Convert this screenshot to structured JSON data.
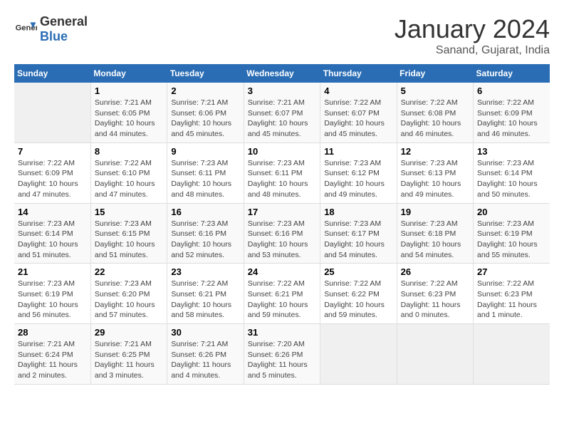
{
  "header": {
    "logo_general": "General",
    "logo_blue": "Blue",
    "month_title": "January 2024",
    "subtitle": "Sanand, Gujarat, India"
  },
  "weekdays": [
    "Sunday",
    "Monday",
    "Tuesday",
    "Wednesday",
    "Thursday",
    "Friday",
    "Saturday"
  ],
  "weeks": [
    [
      {
        "day": "",
        "info": ""
      },
      {
        "day": "1",
        "info": "Sunrise: 7:21 AM\nSunset: 6:05 PM\nDaylight: 10 hours\nand 44 minutes."
      },
      {
        "day": "2",
        "info": "Sunrise: 7:21 AM\nSunset: 6:06 PM\nDaylight: 10 hours\nand 45 minutes."
      },
      {
        "day": "3",
        "info": "Sunrise: 7:21 AM\nSunset: 6:07 PM\nDaylight: 10 hours\nand 45 minutes."
      },
      {
        "day": "4",
        "info": "Sunrise: 7:22 AM\nSunset: 6:07 PM\nDaylight: 10 hours\nand 45 minutes."
      },
      {
        "day": "5",
        "info": "Sunrise: 7:22 AM\nSunset: 6:08 PM\nDaylight: 10 hours\nand 46 minutes."
      },
      {
        "day": "6",
        "info": "Sunrise: 7:22 AM\nSunset: 6:09 PM\nDaylight: 10 hours\nand 46 minutes."
      }
    ],
    [
      {
        "day": "7",
        "info": "Sunrise: 7:22 AM\nSunset: 6:09 PM\nDaylight: 10 hours\nand 47 minutes."
      },
      {
        "day": "8",
        "info": "Sunrise: 7:22 AM\nSunset: 6:10 PM\nDaylight: 10 hours\nand 47 minutes."
      },
      {
        "day": "9",
        "info": "Sunrise: 7:23 AM\nSunset: 6:11 PM\nDaylight: 10 hours\nand 48 minutes."
      },
      {
        "day": "10",
        "info": "Sunrise: 7:23 AM\nSunset: 6:11 PM\nDaylight: 10 hours\nand 48 minutes."
      },
      {
        "day": "11",
        "info": "Sunrise: 7:23 AM\nSunset: 6:12 PM\nDaylight: 10 hours\nand 49 minutes."
      },
      {
        "day": "12",
        "info": "Sunrise: 7:23 AM\nSunset: 6:13 PM\nDaylight: 10 hours\nand 49 minutes."
      },
      {
        "day": "13",
        "info": "Sunrise: 7:23 AM\nSunset: 6:14 PM\nDaylight: 10 hours\nand 50 minutes."
      }
    ],
    [
      {
        "day": "14",
        "info": "Sunrise: 7:23 AM\nSunset: 6:14 PM\nDaylight: 10 hours\nand 51 minutes."
      },
      {
        "day": "15",
        "info": "Sunrise: 7:23 AM\nSunset: 6:15 PM\nDaylight: 10 hours\nand 51 minutes."
      },
      {
        "day": "16",
        "info": "Sunrise: 7:23 AM\nSunset: 6:16 PM\nDaylight: 10 hours\nand 52 minutes."
      },
      {
        "day": "17",
        "info": "Sunrise: 7:23 AM\nSunset: 6:16 PM\nDaylight: 10 hours\nand 53 minutes."
      },
      {
        "day": "18",
        "info": "Sunrise: 7:23 AM\nSunset: 6:17 PM\nDaylight: 10 hours\nand 54 minutes."
      },
      {
        "day": "19",
        "info": "Sunrise: 7:23 AM\nSunset: 6:18 PM\nDaylight: 10 hours\nand 54 minutes."
      },
      {
        "day": "20",
        "info": "Sunrise: 7:23 AM\nSunset: 6:19 PM\nDaylight: 10 hours\nand 55 minutes."
      }
    ],
    [
      {
        "day": "21",
        "info": "Sunrise: 7:23 AM\nSunset: 6:19 PM\nDaylight: 10 hours\nand 56 minutes."
      },
      {
        "day": "22",
        "info": "Sunrise: 7:23 AM\nSunset: 6:20 PM\nDaylight: 10 hours\nand 57 minutes."
      },
      {
        "day": "23",
        "info": "Sunrise: 7:22 AM\nSunset: 6:21 PM\nDaylight: 10 hours\nand 58 minutes."
      },
      {
        "day": "24",
        "info": "Sunrise: 7:22 AM\nSunset: 6:21 PM\nDaylight: 10 hours\nand 59 minutes."
      },
      {
        "day": "25",
        "info": "Sunrise: 7:22 AM\nSunset: 6:22 PM\nDaylight: 10 hours\nand 59 minutes."
      },
      {
        "day": "26",
        "info": "Sunrise: 7:22 AM\nSunset: 6:23 PM\nDaylight: 11 hours\nand 0 minutes."
      },
      {
        "day": "27",
        "info": "Sunrise: 7:22 AM\nSunset: 6:23 PM\nDaylight: 11 hours\nand 1 minute."
      }
    ],
    [
      {
        "day": "28",
        "info": "Sunrise: 7:21 AM\nSunset: 6:24 PM\nDaylight: 11 hours\nand 2 minutes."
      },
      {
        "day": "29",
        "info": "Sunrise: 7:21 AM\nSunset: 6:25 PM\nDaylight: 11 hours\nand 3 minutes."
      },
      {
        "day": "30",
        "info": "Sunrise: 7:21 AM\nSunset: 6:26 PM\nDaylight: 11 hours\nand 4 minutes."
      },
      {
        "day": "31",
        "info": "Sunrise: 7:20 AM\nSunset: 6:26 PM\nDaylight: 11 hours\nand 5 minutes."
      },
      {
        "day": "",
        "info": ""
      },
      {
        "day": "",
        "info": ""
      },
      {
        "day": "",
        "info": ""
      }
    ]
  ]
}
